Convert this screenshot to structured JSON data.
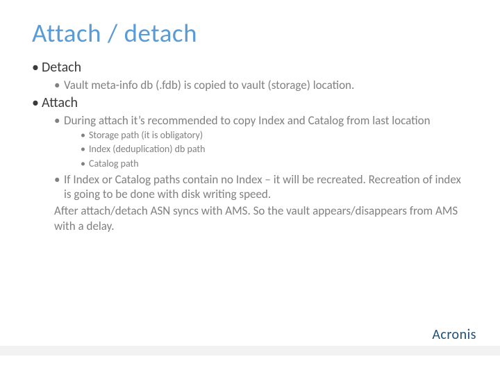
{
  "title": "Attach / detach",
  "items": {
    "detach": {
      "label": "Detach",
      "sub": [
        "Vault meta-info db (.fdb) is copied to vault (storage) location."
      ]
    },
    "attach": {
      "label": "Attach",
      "sub1": "During attach it’s recommended to copy Index and Catalog from last location",
      "sub1_children": [
        "Storage path (it is obligatory)",
        "Index (deduplication) db path",
        "Catalog path"
      ],
      "sub2": "If Index or Catalog paths contain no Index – it will be recreated. Recreation of index is going to be done with disk writing speed.",
      "after": "After attach/detach ASN syncs with AMS. So the vault appears/disappears from AMS with a delay."
    }
  },
  "brand": "Acronis"
}
